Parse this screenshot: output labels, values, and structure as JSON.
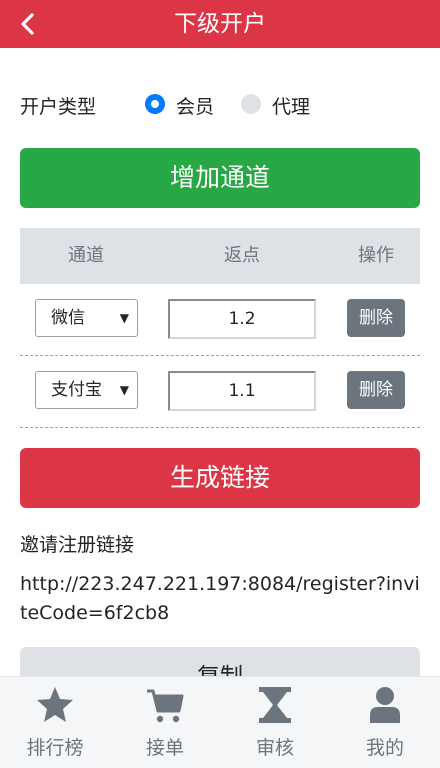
{
  "header": {
    "title": "下级开户",
    "back_icon": "chevron-left-icon"
  },
  "account_type": {
    "label": "开户类型",
    "options": [
      {
        "label": "会员",
        "selected": true
      },
      {
        "label": "代理",
        "selected": false
      }
    ]
  },
  "add_channel_label": "增加通道",
  "table": {
    "headers": [
      "通道",
      "返点",
      "操作"
    ],
    "rows": [
      {
        "channel": "微信",
        "rebate": "1.2",
        "action": "删除"
      },
      {
        "channel": "支付宝",
        "rebate": "1.1",
        "action": "删除"
      }
    ]
  },
  "generate_link_label": "生成链接",
  "invite": {
    "label": "邀请注册链接",
    "link": "http://223.247.221.197:8084/register?inviteCode=6f2cb8"
  },
  "copy_label": "复制",
  "tabbar": [
    {
      "label": "排行榜",
      "icon": "star-icon"
    },
    {
      "label": "接单",
      "icon": "cart-icon"
    },
    {
      "label": "审核",
      "icon": "hourglass-icon"
    },
    {
      "label": "我的",
      "icon": "user-icon"
    }
  ],
  "colors": {
    "primary_red": "#dc3545",
    "green": "#28a745",
    "blue": "#007bff",
    "gray": "#6c757d",
    "light_gray": "#dee2e6"
  }
}
